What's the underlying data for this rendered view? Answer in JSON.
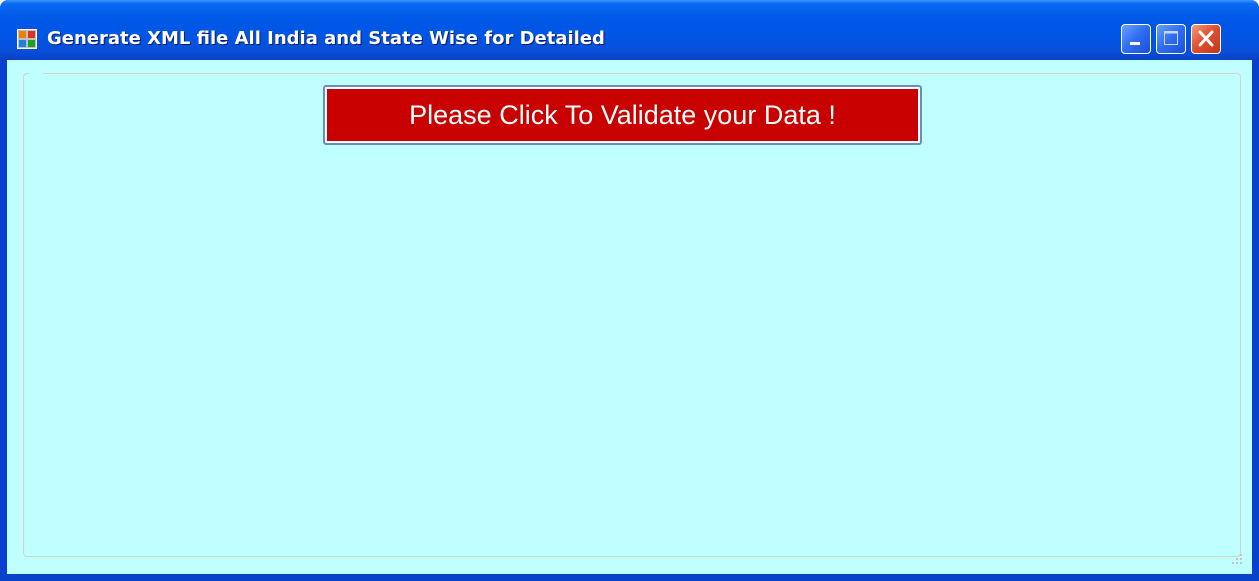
{
  "window": {
    "title": "Generate XML file All India and State Wise for Detailed",
    "icon": "app-form-icon",
    "controls": {
      "minimize": "minimize-icon",
      "maximize": "maximize-icon",
      "close": "close-icon"
    }
  },
  "main": {
    "validate_button_label": "Please Click To Validate your Data !"
  },
  "colors": {
    "client_background": "#c0ffff",
    "validate_button": "#c80000",
    "validate_text": "#ffffff",
    "titlebar": "#0055e5"
  }
}
